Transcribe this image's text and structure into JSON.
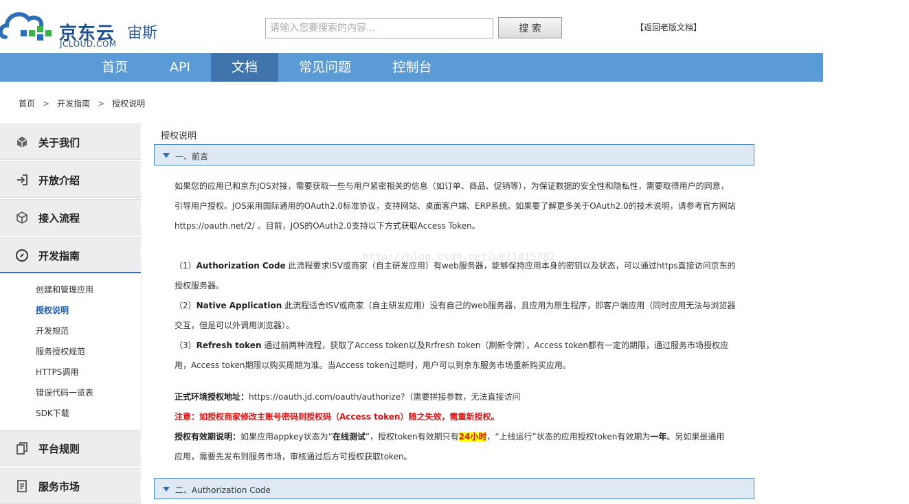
{
  "brand": {
    "name_cn": "京东云",
    "product": "宙斯",
    "name_en": "JCLOUD.COM"
  },
  "search": {
    "placeholder": "请输入您要搜索的内容...",
    "button": "搜 索"
  },
  "old_docs_link": "【返回老版文档】",
  "nav": {
    "items": [
      "首页",
      "API",
      "文档",
      "常见问题",
      "控制台"
    ],
    "active": "文档"
  },
  "breadcrumb": [
    "首页",
    "开发指南",
    "授权说明"
  ],
  "sidebar": {
    "sections": [
      {
        "label": "关于我们",
        "icon": "box-icon"
      },
      {
        "label": "开放介绍",
        "icon": "sign-in-icon"
      },
      {
        "label": "接入流程",
        "icon": "cube-icon"
      },
      {
        "label": "开发指南",
        "icon": "compass-icon"
      },
      {
        "label": "平台规则",
        "icon": "copy-icon"
      },
      {
        "label": "服务市场",
        "icon": "document-list-icon"
      }
    ],
    "sub_items": [
      "创建和管理应用",
      "授权说明",
      "开发规范",
      "服务授权规范",
      "HTTPS调用",
      "错误代码一览表",
      "SDK下载"
    ],
    "active_sub": "授权说明"
  },
  "content": {
    "title": "授权说明",
    "sections": [
      "一、前言",
      "二、Authorization Code"
    ],
    "intro_lines": [
      "如果您的应用已和京东JOS对接，需要获取一些与用户紧密相关的信息（如订单、商品、促销等），为保证数据的安全性和隐私性，需要取得用户的同意，",
      "引导用户授权。JOS采用国际通用的OAuth2.0标准协议，支持网站、桌面客户端、ERP系统。如果要了解更多关于OAuth2.0的技术说明，请参考官方网站",
      "https://oauth.net/2/ 。目前，JOS的OAuth2.0支持以下方式获取Access Token。"
    ],
    "watermark": "http://blog.csdn.net/u011415782",
    "modes": [
      {
        "prefix": "（1）",
        "name": "Authorization Code",
        "line1": " 此流程要求ISV或商家（自主研发应用）有web服务器，能够保持应用本身的密钥以及状态，可以通过https直接访问京东的",
        "line2": "授权服务器。"
      },
      {
        "prefix": "（2）",
        "name": "Native Application",
        "line1": " 此流程适合ISV或商家（自主研发应用）没有自己的web服务器，且应用为原生程序，即客户端应用（同时应用无法与浏览器",
        "line2": "交互，但是可以外调用浏览器）。"
      },
      {
        "prefix": "（3）",
        "name": "Refresh token",
        "line1": " 通过前两种流程，获取了Access token以及Rrfresh token（刷新令牌），Access token都有一定的期限，通过服务市场授权应",
        "line2": "用，Access token期限以购买周期为准。当Access token过期时，用户可以到京东服务市场重新购买应用。"
      }
    ],
    "auth_url_label": "正式环境授权地址：",
    "auth_url": "https://oauth.jd.com/oauth/authorize?（需要拼接参数，无法直接访问",
    "notice": "注意：如授权商家修改主账号密码则授权码（Access token）随之失效，需重新授权。",
    "validity": {
      "label": "授权有效期说明：",
      "t1": "如果应用appkey状态为“",
      "b1": "在线测试",
      "t2": "”，授权token有效期只有",
      "hl": "24小时",
      "t3": "，“上线运行”状态的应用授权token有效期为",
      "b2": "一年",
      "t4": "。另如果是通用",
      "line2": "应用，需要先发布到服务市场，审核通过后方可授权获取token。"
    }
  },
  "colors": {
    "nav_bg": "#5b9bd5",
    "nav_active": "#3f74ad",
    "section_bg": "#dfe9f3",
    "notice_red": "#e01010",
    "highlight": "#ffff00"
  }
}
